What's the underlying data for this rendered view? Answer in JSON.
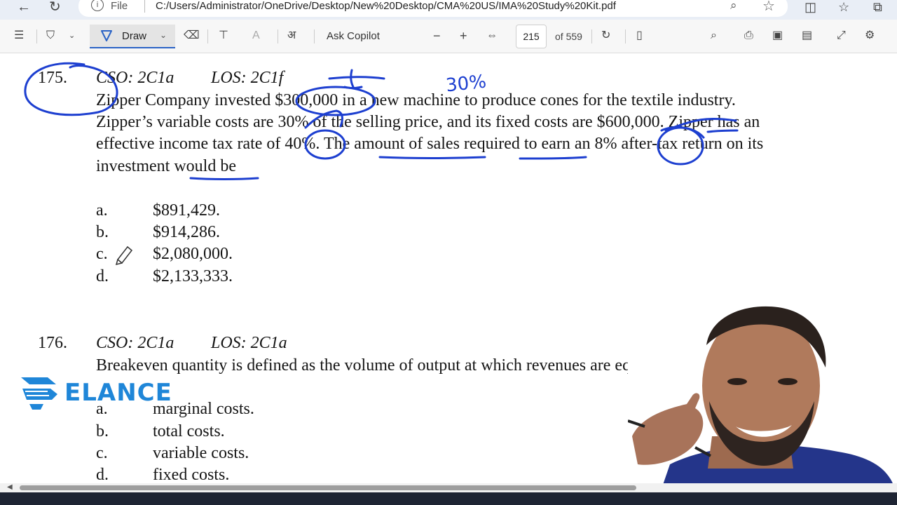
{
  "browser": {
    "scheme_label": "File",
    "url": "C:/Users/Administrator/OneDrive/Desktop/New%20Desktop/CMA%20US/IMA%20Study%20Kit.pdf"
  },
  "toolbar": {
    "draw_label": "Draw",
    "ask_copilot_label": "Ask Copilot",
    "zoom_out_label": "−",
    "zoom_in_label": "+",
    "page_number": "215",
    "page_total": "of 559"
  },
  "questions": [
    {
      "number": "175.",
      "cso": "CSO: 2C1a",
      "los": "LOS: 2C1f",
      "lines": [
        "Zipper Company invested $300,000 in a new machine to produce cones for the textile industry.",
        "Zipper’s variable costs are 30% of the selling price, and its fixed costs are $600,000. Zipper has an",
        "effective income tax rate of 40%.  The amount of sales required to earn an 8% after-tax return on its",
        "investment would be"
      ],
      "options": [
        {
          "letter": "a.",
          "text": "$891,429."
        },
        {
          "letter": "b.",
          "text": "$914,286."
        },
        {
          "letter": "c.",
          "text": "$2,080,000."
        },
        {
          "letter": "d.",
          "text": "$2,133,333."
        }
      ]
    },
    {
      "number": "176.",
      "cso": "CSO: 2C1a",
      "los": "LOS: 2C1a",
      "lines": [
        "Breakeven quantity is defined as the volume of output at which revenues are equ"
      ],
      "options": [
        {
          "letter": "a.",
          "text": "marginal costs."
        },
        {
          "letter": "b.",
          "text": "total costs."
        },
        {
          "letter": "c.",
          "text": "variable costs."
        },
        {
          "letter": "d.",
          "text": "fixed costs."
        }
      ]
    }
  ],
  "annotations": {
    "handwritten_note": "30%"
  },
  "logo": {
    "text": "ELANCE",
    "color": "#1f86d8"
  },
  "colors": {
    "ink": "#1d3fd0",
    "accent": "#2b63c6"
  }
}
